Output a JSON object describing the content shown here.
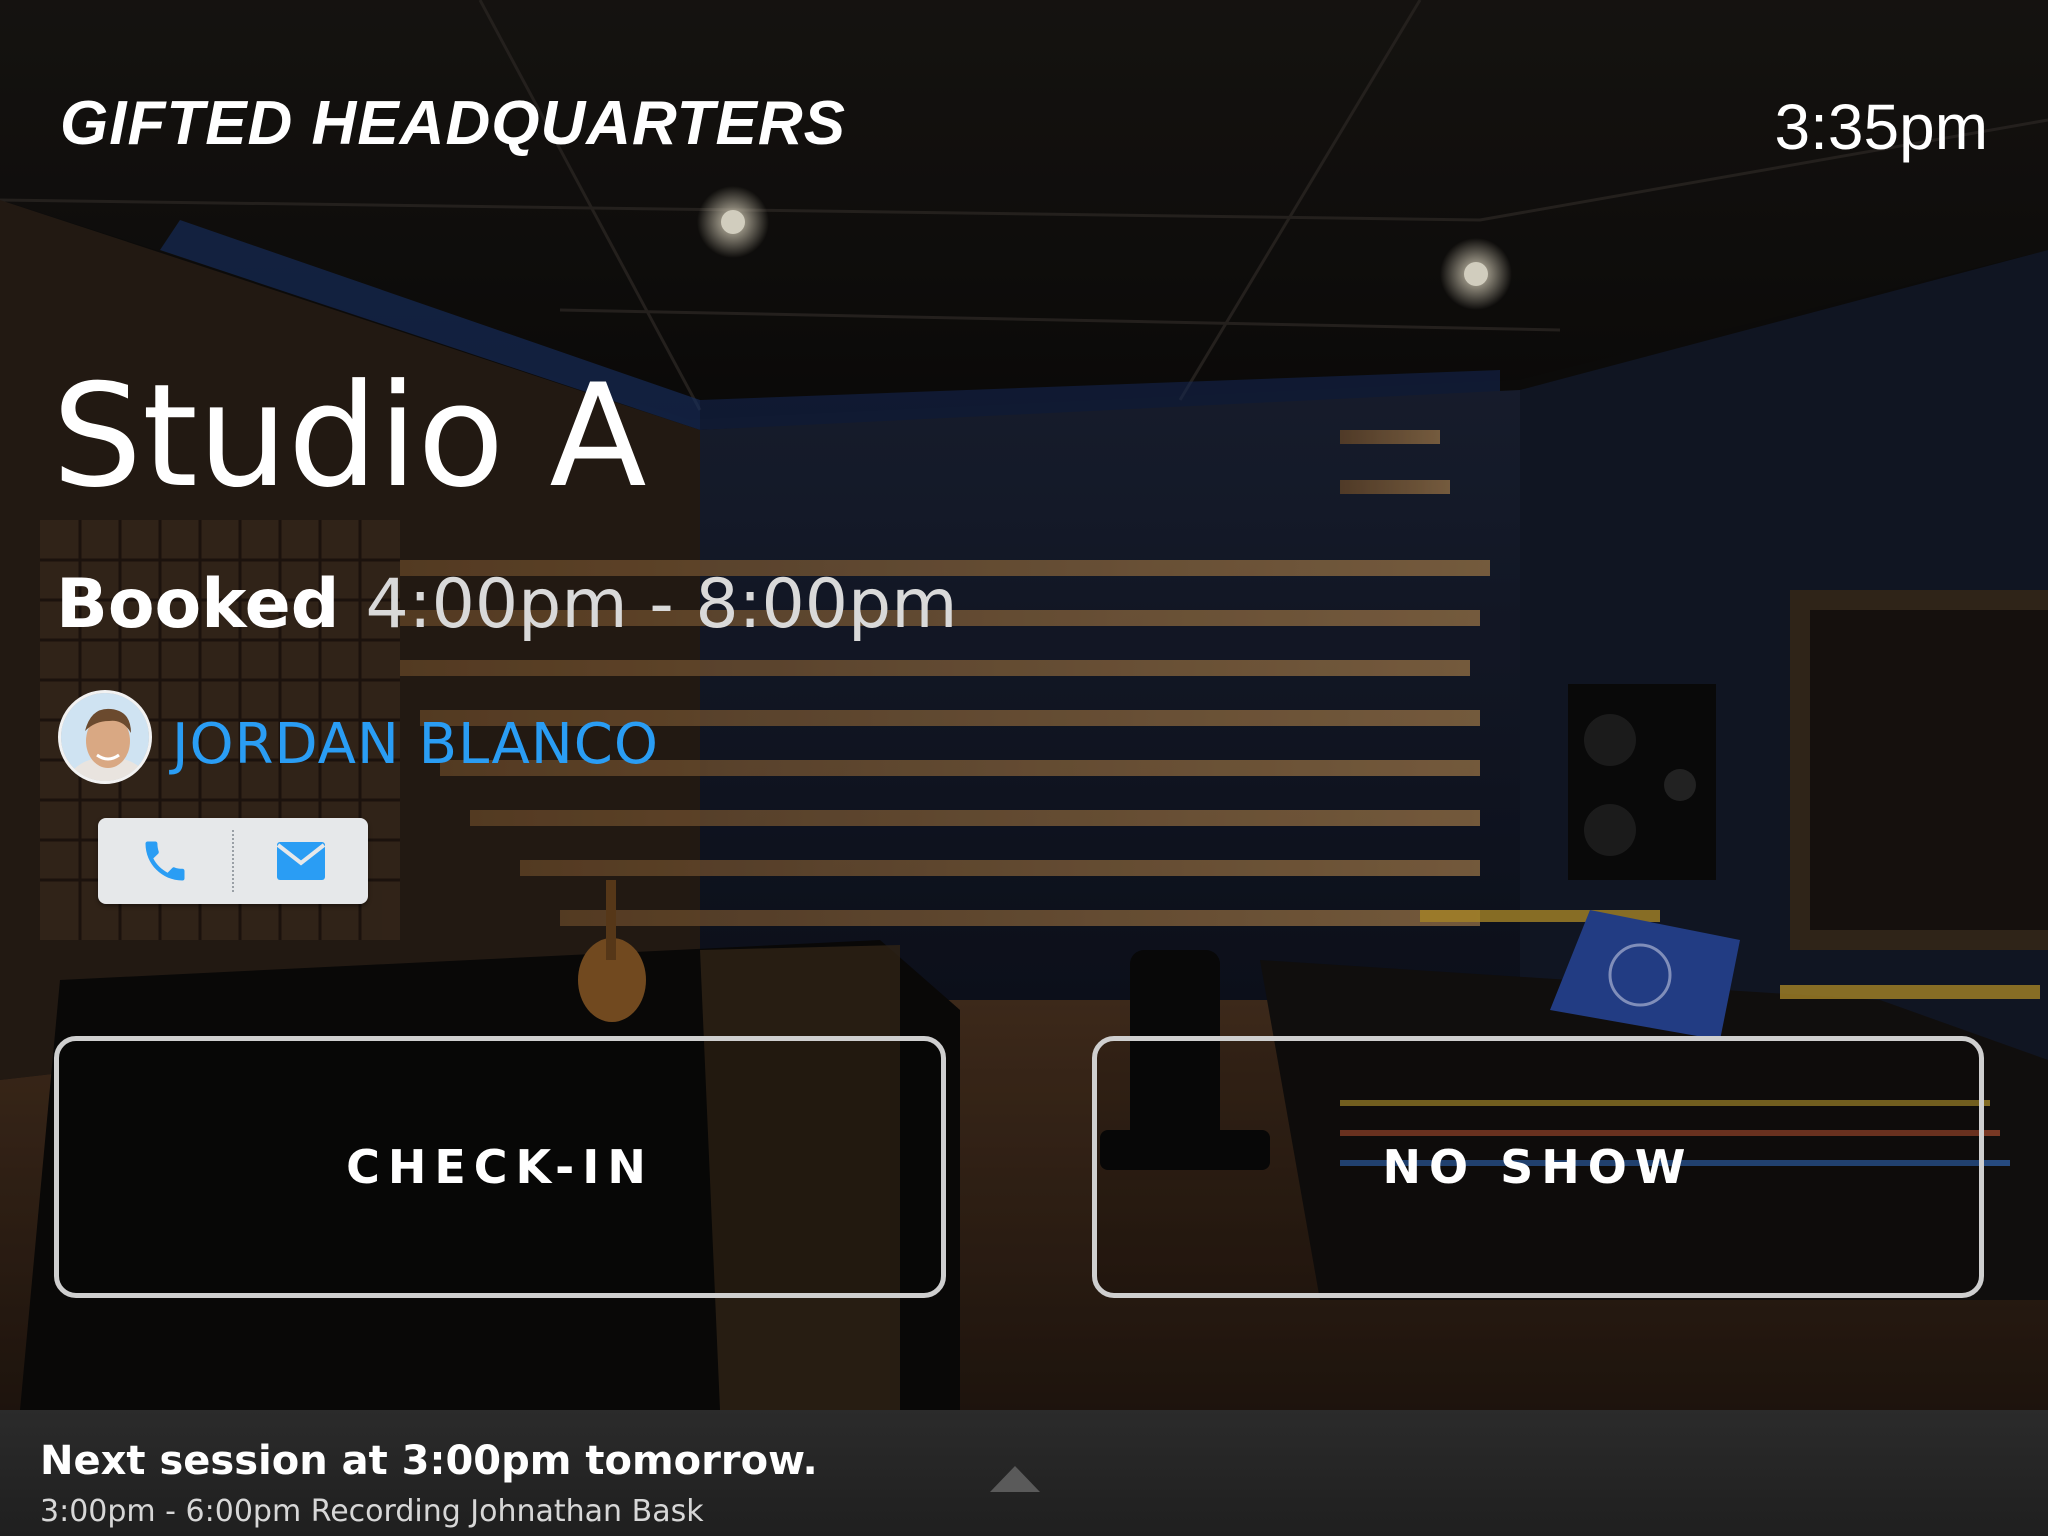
{
  "header": {
    "venue": "GIFTED HEADQUARTERS",
    "time": "3:35pm"
  },
  "room": {
    "name": "Studio A",
    "status": "Booked",
    "time_range": "4:00pm - 8:00pm"
  },
  "client": {
    "name": "JORDAN BLANCO",
    "avatar_icon": "user-avatar"
  },
  "contact": {
    "phone_icon": "phone-icon",
    "email_icon": "mail-icon"
  },
  "actions": {
    "check_in": "CHECK-IN",
    "no_show": "NO SHOW"
  },
  "footer": {
    "next_title": "Next session at 3:00pm tomorrow.",
    "next_detail": "3:00pm - 6:00pm Recording Johnathan Bask",
    "expand_icon": "chevron-up-icon"
  },
  "colors": {
    "accent": "#2a9df4",
    "button_border": "#cfcfcf",
    "footer_bg": "#2b2b2b",
    "contact_bar_bg": "#e6e8ea"
  }
}
